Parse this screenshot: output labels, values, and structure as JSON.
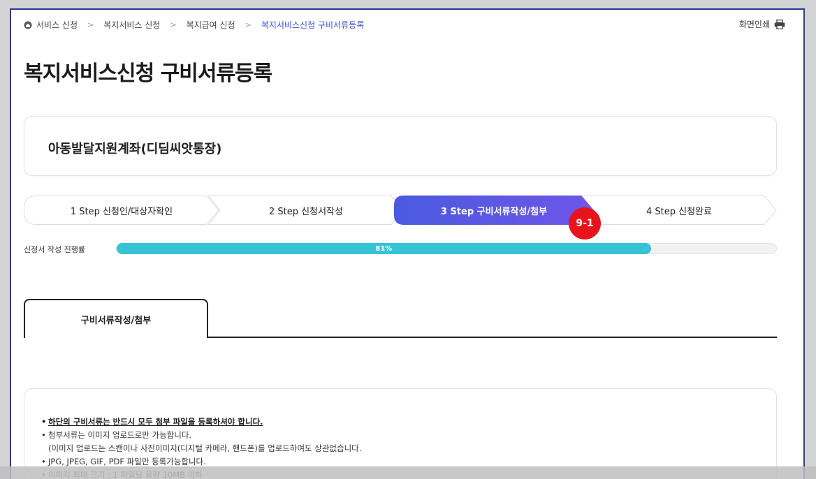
{
  "breadcrumb": {
    "items": [
      "서비스 신청",
      "복지서비스 신청",
      "복지급여 신청",
      "복지서비스신청 구비서류등록"
    ],
    "separator": ">"
  },
  "print": {
    "label": "화면인쇄",
    "icon": "printer-icon"
  },
  "page_title": "복지서비스신청 구비서류등록",
  "service": {
    "name": "아동발달지원계좌(디딤씨앗통장)"
  },
  "steps": [
    {
      "label": "1 Step 신청인/대상자확인",
      "state": "done"
    },
    {
      "label": "2 Step 신청서작성",
      "state": "done"
    },
    {
      "label": "3 Step 구비서류작성/첨부",
      "state": "active"
    },
    {
      "label": "4 Step 신청완료",
      "state": "pending"
    }
  ],
  "badge": {
    "label": "9-1",
    "color": "#e8141c"
  },
  "progress": {
    "label": "신청서 작성 진행률",
    "value_text": "81%",
    "value": 81,
    "fill_color": "#36c3d6"
  },
  "tabs": [
    {
      "label": "구비서류작성/첨부",
      "active": true
    }
  ],
  "notices": [
    {
      "text": "하단의 구비서류는 반드시 모두 첨부 파일을 등록하셔야 합니다.",
      "style": "strong"
    },
    {
      "text": "첨부서류는 이미지 업로드로만 가능합니다.",
      "style": ""
    },
    {
      "text": "(이미지 업로드는 스캔이나 사진이미지(디지털 카메라, 핸드폰)를 업로드하여도 상관없습니다.",
      "style": "cont"
    },
    {
      "text": "JPG, JPEG, GIF, PDF 파일만 등록가능합니다.",
      "style": ""
    },
    {
      "text": "이미지 최대 크기 : 1 파일당 용량 10MB 이하",
      "style": ""
    }
  ],
  "colors": {
    "accent": "#3b4fd8",
    "step_active_start": "#4a5ae0",
    "step_active_end": "#6f56e8",
    "frame_border": "#2e3a8c"
  }
}
